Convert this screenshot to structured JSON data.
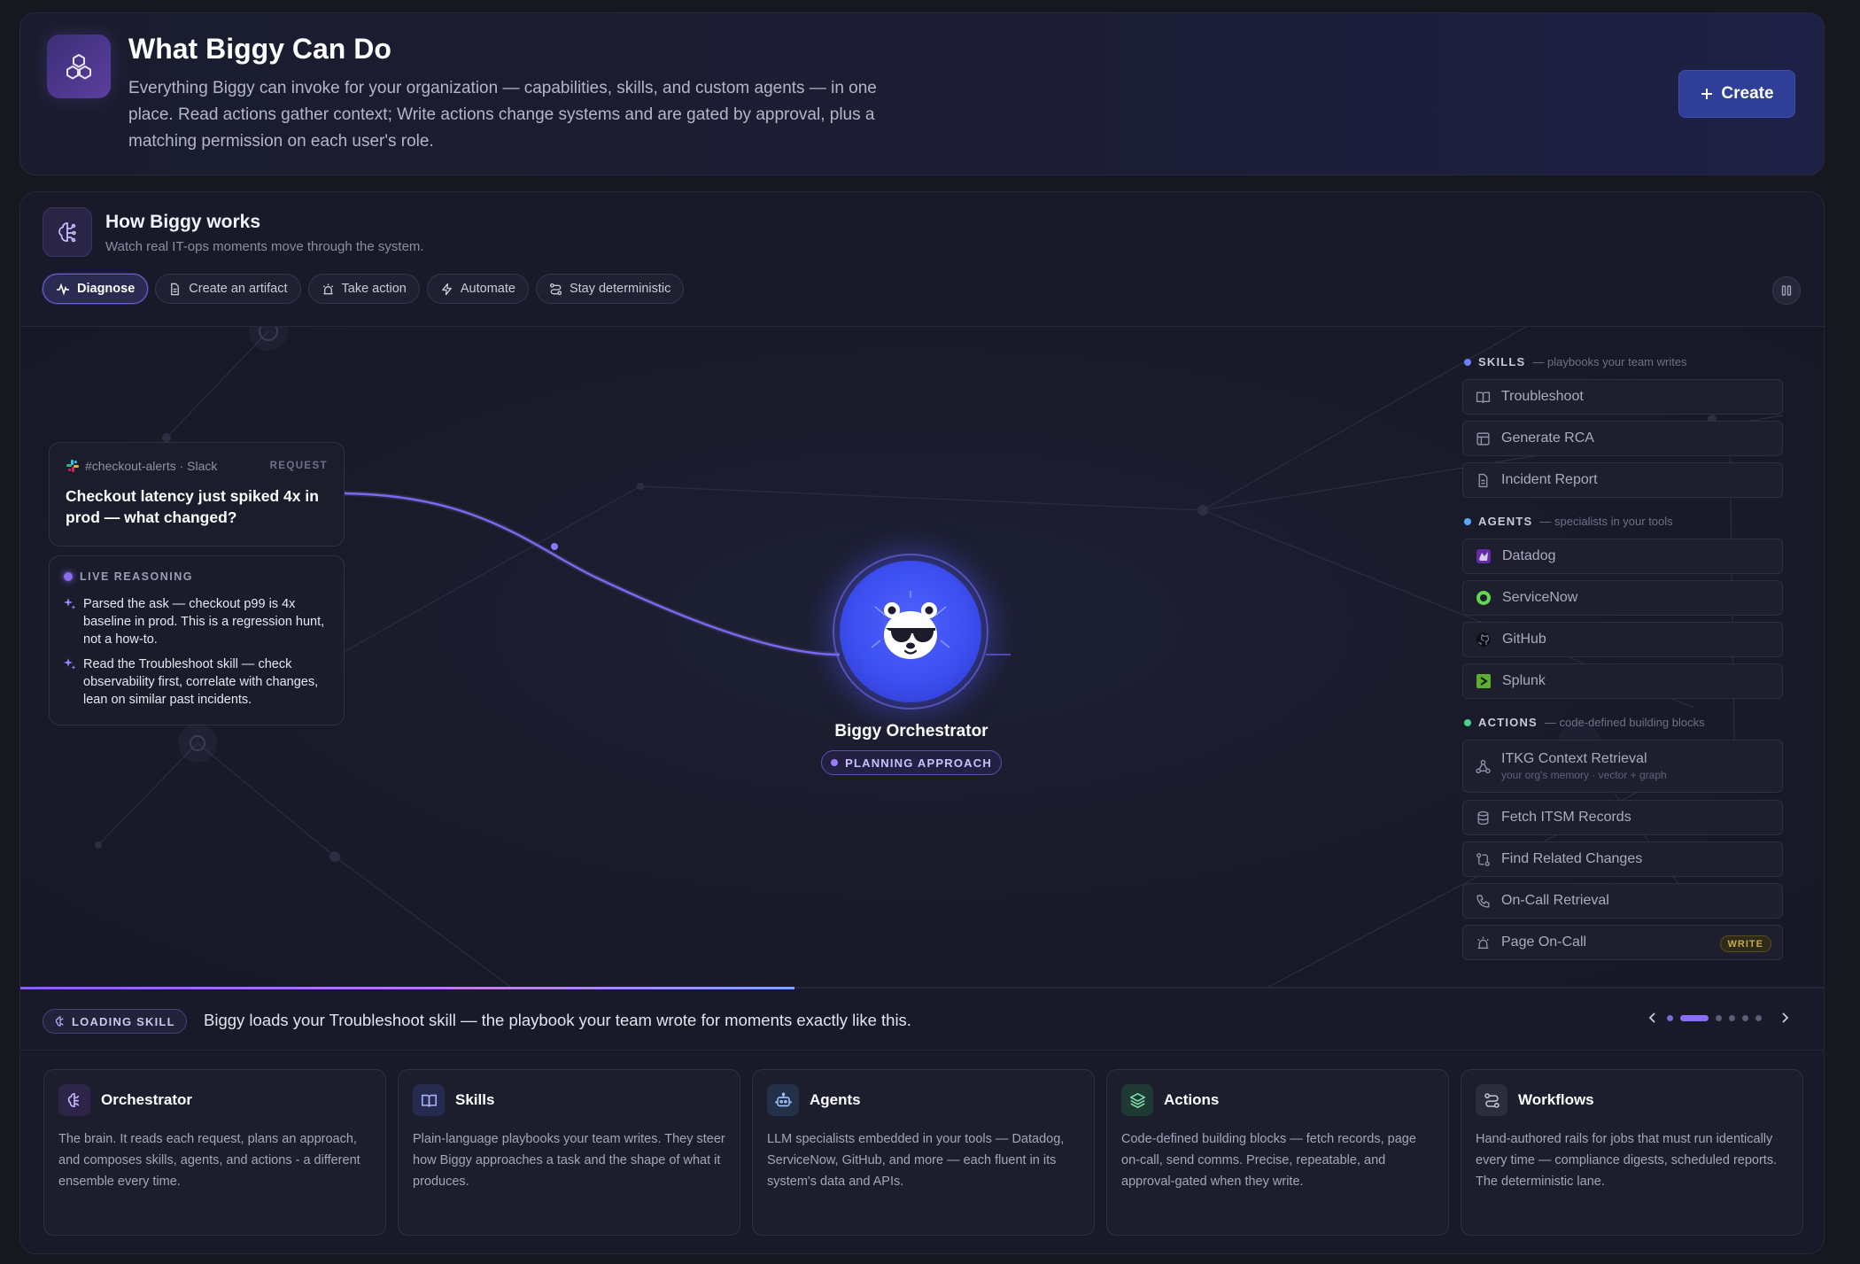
{
  "header": {
    "title": "What Biggy Can Do",
    "description": "Everything Biggy can invoke for your organization — capabilities, skills, and custom agents — in one place. Read actions gather context; Write actions change systems and are gated by approval, plus a matching permission on each user's role.",
    "create_label": "Create"
  },
  "how": {
    "title": "How Biggy works",
    "subtitle": "Watch real IT-ops moments move through the system.",
    "tabs": [
      {
        "label": "Diagnose",
        "active": true
      },
      {
        "label": "Create an artifact"
      },
      {
        "label": "Take action"
      },
      {
        "label": "Automate"
      },
      {
        "label": "Stay deterministic"
      }
    ]
  },
  "request": {
    "source": "#checkout-alerts · Slack",
    "tag": "REQUEST",
    "text": "Checkout latency just spiked 4x in prod — what changed?"
  },
  "reasoning": {
    "label": "LIVE REASONING",
    "items": [
      "Parsed the ask — checkout p99 is 4x baseline in prod. This is a regression hunt, not a how-to.",
      "Read the Troubleshoot skill — check observability first, correlate with changes, lean on similar past incidents."
    ]
  },
  "orchestrator": {
    "name": "Biggy Orchestrator",
    "status": "PLANNING APPROACH"
  },
  "panel": {
    "skills": {
      "name": "SKILLS",
      "desc": "— playbooks your team writes",
      "items": [
        "Troubleshoot",
        "Generate RCA",
        "Incident Report"
      ]
    },
    "agents": {
      "name": "AGENTS",
      "desc": "— specialists in your tools",
      "items": [
        "Datadog",
        "ServiceNow",
        "GitHub",
        "Splunk"
      ]
    },
    "actions": {
      "name": "ACTIONS",
      "desc": "— code-defined building blocks",
      "items": [
        {
          "label": "ITKG Context Retrieval",
          "sub": "your org's memory · vector + graph"
        },
        {
          "label": "Fetch ITSM Records"
        },
        {
          "label": "Find Related Changes"
        },
        {
          "label": "On-Call Retrieval"
        },
        {
          "label": "Page On-Call",
          "badge": "WRITE"
        }
      ]
    }
  },
  "step": {
    "badge": "LOADING SKILL",
    "text": "Biggy loads your Troubleshoot skill — the playbook your team wrote for moments exactly like this.",
    "current": 2,
    "total": 7,
    "progress": 0.43
  },
  "features": [
    {
      "title": "Orchestrator",
      "desc": "The brain. It reads each request, plans an approach, and composes skills, agents, and actions - a different ensemble every time.",
      "icon": "brain-icon"
    },
    {
      "title": "Skills",
      "desc": "Plain-language playbooks your team writes. They steer how Biggy approaches a task and the shape of what it produces.",
      "icon": "book-icon"
    },
    {
      "title": "Agents",
      "desc": "LLM specialists embedded in your tools — Datadog, ServiceNow, GitHub, and more — each fluent in its system's data and APIs.",
      "icon": "robot-icon"
    },
    {
      "title": "Actions",
      "desc": "Code-defined building blocks — fetch records, page on-call, send comms. Precise, repeatable, and approval-gated when they write.",
      "icon": "layers-icon"
    },
    {
      "title": "Workflows",
      "desc": "Hand-authored rails for jobs that must run identically every time — compliance digests, scheduled reports. The deterministic lane.",
      "icon": "route-icon"
    }
  ],
  "colors": {
    "accent": "#8a6cf6",
    "create_button": "#2f3f98",
    "orchestrator": "#4f63ff",
    "write_badge": "#c7a84a"
  }
}
